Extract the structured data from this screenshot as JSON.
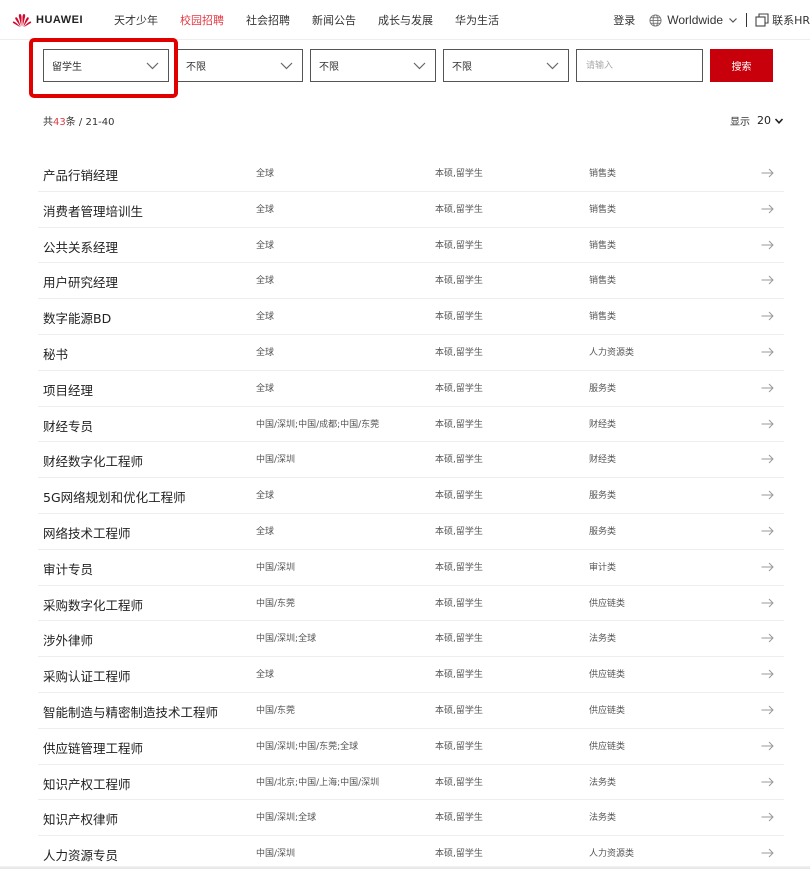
{
  "brand": {
    "logo_text": "HUAWEI",
    "accent_color": "#c7000b"
  },
  "nav": {
    "items": [
      {
        "label": "天才少年",
        "active": false
      },
      {
        "label": "校园招聘",
        "active": true
      },
      {
        "label": "社会招聘",
        "active": false
      },
      {
        "label": "新闻公告",
        "active": false
      },
      {
        "label": "成长与发展",
        "active": false
      },
      {
        "label": "华为生活",
        "active": false
      }
    ],
    "login": "登录",
    "region": "Worldwide",
    "hr_contact": "联系HR"
  },
  "filters": {
    "dropdowns": [
      {
        "value": "留学生"
      },
      {
        "value": "不限"
      },
      {
        "value": "不限"
      },
      {
        "value": "不限"
      }
    ],
    "search_placeholder": "请输入",
    "search_button": "搜索"
  },
  "results": {
    "prefix": "共",
    "total": "43",
    "suffix": "条 / 21-40",
    "page_size_label": "显示",
    "page_size_value": "20"
  },
  "jobs": [
    {
      "title": "产品行销经理",
      "location": "全球",
      "education": "本硕,留学生",
      "category": "销售类"
    },
    {
      "title": "消费者管理培训生",
      "location": "全球",
      "education": "本硕,留学生",
      "category": "销售类"
    },
    {
      "title": "公共关系经理",
      "location": "全球",
      "education": "本硕,留学生",
      "category": "销售类"
    },
    {
      "title": "用户研究经理",
      "location": "全球",
      "education": "本硕,留学生",
      "category": "销售类"
    },
    {
      "title": "数字能源BD",
      "location": "全球",
      "education": "本硕,留学生",
      "category": "销售类"
    },
    {
      "title": "秘书",
      "location": "全球",
      "education": "本硕,留学生",
      "category": "人力资源类"
    },
    {
      "title": "项目经理",
      "location": "全球",
      "education": "本硕,留学生",
      "category": "服务类"
    },
    {
      "title": "财经专员",
      "location": "中国/深圳;中国/成都;中国/东莞",
      "education": "本硕,留学生",
      "category": "财经类"
    },
    {
      "title": "财经数字化工程师",
      "location": "中国/深圳",
      "education": "本硕,留学生",
      "category": "财经类"
    },
    {
      "title": "5G网络规划和优化工程师",
      "location": "全球",
      "education": "本硕,留学生",
      "category": "服务类"
    },
    {
      "title": "网络技术工程师",
      "location": "全球",
      "education": "本硕,留学生",
      "category": "服务类"
    },
    {
      "title": "审计专员",
      "location": "中国/深圳",
      "education": "本硕,留学生",
      "category": "审计类"
    },
    {
      "title": "采购数字化工程师",
      "location": "中国/东莞",
      "education": "本硕,留学生",
      "category": "供应链类"
    },
    {
      "title": "涉外律师",
      "location": "中国/深圳;全球",
      "education": "本硕,留学生",
      "category": "法务类"
    },
    {
      "title": "采购认证工程师",
      "location": "全球",
      "education": "本硕,留学生",
      "category": "供应链类"
    },
    {
      "title": "智能制造与精密制造技术工程师",
      "location": "中国/东莞",
      "education": "本硕,留学生",
      "category": "供应链类"
    },
    {
      "title": "供应链管理工程师",
      "location": "中国/深圳;中国/东莞;全球",
      "education": "本硕,留学生",
      "category": "供应链类"
    },
    {
      "title": "知识产权工程师",
      "location": "中国/北京;中国/上海;中国/深圳",
      "education": "本硕,留学生",
      "category": "法务类"
    },
    {
      "title": "知识产权律师",
      "location": "中国/深圳;全球",
      "education": "本硕,留学生",
      "category": "法务类"
    },
    {
      "title": "人力资源专员",
      "location": "中国/深圳",
      "education": "本硕,留学生",
      "category": "人力资源类"
    }
  ]
}
